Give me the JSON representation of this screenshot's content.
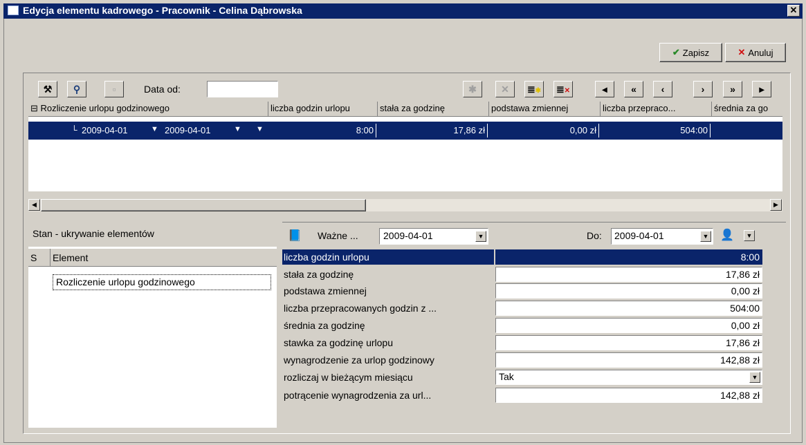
{
  "window": {
    "title": "Edycja elementu kadrowego - Pracownik - Celina Dąbrowska",
    "close_glyph": "✕"
  },
  "actions": {
    "save_label": "Zapisz",
    "cancel_label": "Anuluj"
  },
  "toolbar": {
    "date_from_label": "Data od:",
    "date_from_value": ""
  },
  "grid": {
    "tree_header": "Rozliczenie urlopu godzinowego",
    "columns": [
      "liczba godzin urlopu",
      "stała za godzinę",
      "podstawa zmiennej",
      "liczba przepraco...",
      "średnia za go"
    ],
    "row": {
      "date_from": "2009-04-01",
      "date_to": "2009-04-01",
      "values": [
        "8:00",
        "17,86 zł",
        "0,00 zł",
        "504:00",
        ""
      ]
    }
  },
  "left_panel": {
    "title": "Stan - ukrywanie elementów",
    "header_s": "S",
    "header_element": "Element",
    "items": [
      "Rozliczenie urlopu godzinowego"
    ]
  },
  "detail": {
    "valid_label": "Ważne ...",
    "valid_from": "2009-04-01",
    "to_label": "Do:",
    "valid_to": "2009-04-01",
    "rows": [
      {
        "label": "liczba godzin urlopu",
        "value": "8:00"
      },
      {
        "label": "stała za godzinę",
        "value": "17,86 zł"
      },
      {
        "label": "podstawa zmiennej",
        "value": "0,00 zł"
      },
      {
        "label": "liczba przepracowanych godzin z ...",
        "value": "504:00"
      },
      {
        "label": "średnia za godzinę",
        "value": "0,00 zł"
      },
      {
        "label": "stawka za godzinę urlopu",
        "value": "17,86 zł"
      },
      {
        "label": "wynagrodzenie za urlop godzinowy",
        "value": "142,88 zł"
      },
      {
        "label": "rozliczaj w bieżącym miesiącu",
        "value": "Tak"
      },
      {
        "label": "potrącenie wynagrodzenia za url...",
        "value": "142,88 zł"
      }
    ]
  },
  "colors": {
    "title_bar": "#0a246a",
    "selection": "#0a246a",
    "face": "#d4d0c8"
  }
}
